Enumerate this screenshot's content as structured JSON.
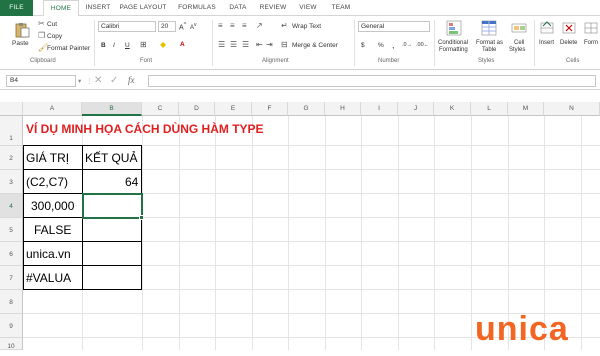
{
  "tabs": [
    "FILE",
    "HOME",
    "INSERT",
    "PAGE LAYOUT",
    "FORMULAS",
    "DATA",
    "REVIEW",
    "VIEW",
    "TEAM"
  ],
  "clipboard": {
    "paste": "Paste",
    "cut": "Cut",
    "copy": "Copy",
    "format_painter": "Format Painter",
    "label": "Clipboard"
  },
  "font": {
    "name": "Calibri",
    "size": "20",
    "label": "Font",
    "bold": "B",
    "italic": "I",
    "underline": "U"
  },
  "alignment": {
    "wrap_text": "Wrap Text",
    "merge_center": "Merge & Center",
    "label": "Alignment"
  },
  "number": {
    "format": "General",
    "currency": "$",
    "percent": "%",
    "comma": ",",
    "label": "Number"
  },
  "styles": {
    "conditional": "Conditional",
    "conditional2": "Formatting",
    "format_as": "Format as",
    "format_as2": "Table",
    "cell_styles": "Cell",
    "cell_styles2": "Styles",
    "label": "Styles"
  },
  "cells": {
    "insert": "Insert",
    "delete": "Delete",
    "format": "Form",
    "label": "Cells"
  },
  "formula_bar": {
    "name_box": "B4",
    "fx": "fx"
  },
  "columns": [
    "A",
    "B",
    "C",
    "D",
    "E",
    "F",
    "G",
    "H",
    "I",
    "J",
    "K",
    "L",
    "M",
    "N"
  ],
  "rows": [
    "1",
    "2",
    "3",
    "4",
    "5",
    "6",
    "7",
    "8",
    "9",
    "10"
  ],
  "sheet": {
    "title": "VÍ DỤ MINH HỌA CÁCH DÙNG HÀM TYPE",
    "header_value": "GIÁ TRỊ",
    "header_result": "KẾT QUẢ",
    "a3": "(C2,C7)",
    "b3": "64",
    "a4": "300,000",
    "a5": "FALSE",
    "a6": "unica.vn",
    "a7": "#VALUA"
  },
  "watermark": "unica",
  "colors": {
    "accent": "#217346",
    "title_red": "#e02020",
    "watermark_orange": "#f26522",
    "watermark_navy": "#1b3b6f"
  }
}
